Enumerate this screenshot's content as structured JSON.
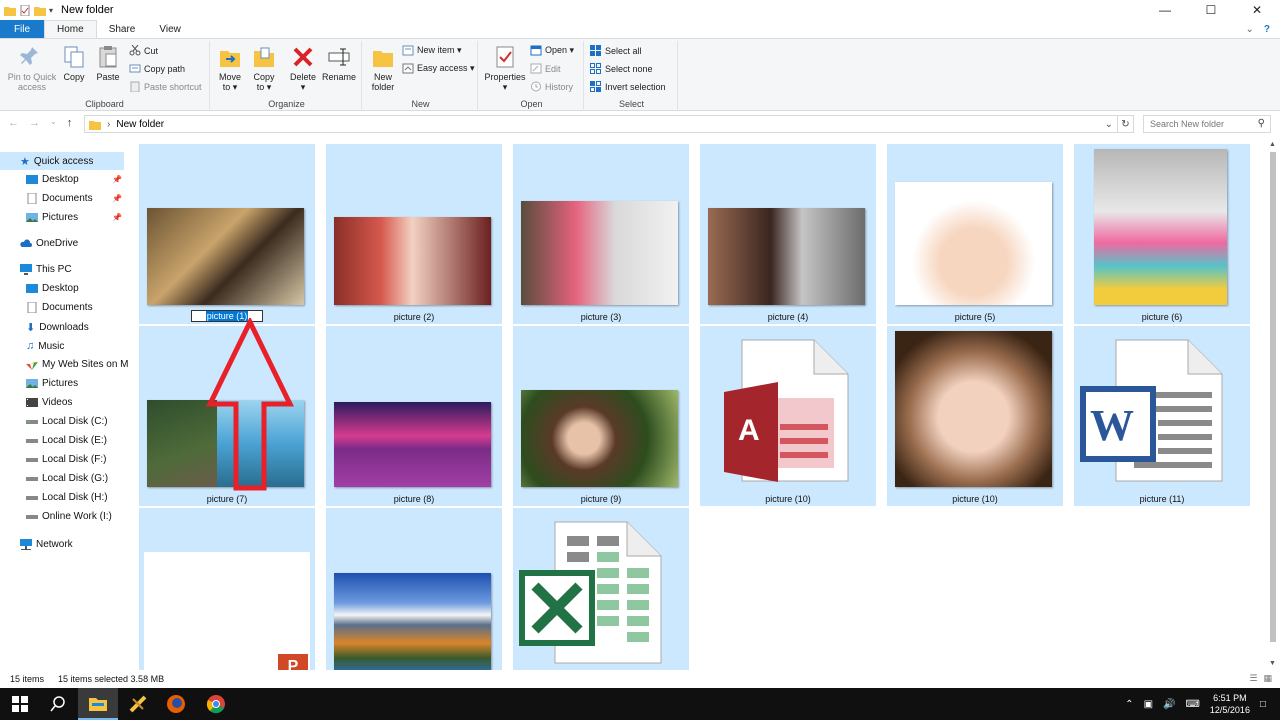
{
  "window": {
    "title": "New folder",
    "controls": [
      "minimize",
      "maximize",
      "close"
    ]
  },
  "tabs": {
    "file": "File",
    "home": "Home",
    "share": "Share",
    "view": "View"
  },
  "ribbon": {
    "clipboard": {
      "label": "Clipboard",
      "pin": "Pin to Quick access",
      "pin_l1": "Pin to Quick",
      "pin_l2": "access",
      "copy": "Copy",
      "paste": "Paste",
      "cut": "Cut",
      "copy_path": "Copy path",
      "paste_shortcut": "Paste shortcut"
    },
    "organize": {
      "label": "Organize",
      "move_l1": "Move",
      "move_l2": "to ▾",
      "copy_l1": "Copy",
      "copy_l2": "to ▾",
      "delete_l1": "Delete",
      "delete_l2": "▾",
      "rename": "Rename"
    },
    "new": {
      "label": "New",
      "folder_l1": "New",
      "folder_l2": "folder",
      "new_item": "New item ▾",
      "easy_access": "Easy access ▾"
    },
    "open": {
      "label": "Open",
      "properties_l1": "Properties",
      "properties_l2": "▾",
      "open": "Open ▾",
      "edit": "Edit",
      "history": "History"
    },
    "select": {
      "label": "Select",
      "select_all": "Select all",
      "select_none": "Select none",
      "invert": "Invert selection"
    }
  },
  "address": {
    "path": "New folder",
    "search_placeholder": "Search New folder"
  },
  "nav_pane": {
    "quick_access": "Quick access",
    "qa_items": [
      "Desktop",
      "Documents",
      "Pictures"
    ],
    "onedrive": "OneDrive",
    "this_pc": "This PC",
    "pc_items": [
      "Desktop",
      "Documents",
      "Downloads",
      "Music",
      "My Web Sites on M",
      "Pictures",
      "Videos",
      "Local Disk (C:)",
      "Local Disk (E:)",
      "Local Disk (F:)",
      "Local Disk (G:)",
      "Local Disk (H:)",
      "Online Work (I:)"
    ],
    "network": "Network"
  },
  "files": [
    {
      "name": "picture (1)",
      "kind": "photo",
      "renaming": true
    },
    {
      "name": "picture (2)",
      "kind": "photo"
    },
    {
      "name": "picture (3)",
      "kind": "photo"
    },
    {
      "name": "picture (4)",
      "kind": "photo"
    },
    {
      "name": "picture (5)",
      "kind": "photo"
    },
    {
      "name": "picture (6)",
      "kind": "photo"
    },
    {
      "name": "picture (7)",
      "kind": "photo"
    },
    {
      "name": "picture (8)",
      "kind": "photo"
    },
    {
      "name": "picture (9)",
      "kind": "photo"
    },
    {
      "name": "picture (10)",
      "kind": "access-doc"
    },
    {
      "name": "picture (10)",
      "kind": "photo"
    },
    {
      "name": "picture (11)",
      "kind": "word-doc"
    },
    {
      "name": "",
      "kind": "powerpoint-doc"
    },
    {
      "name": "",
      "kind": "photo"
    },
    {
      "name": "",
      "kind": "excel-doc"
    }
  ],
  "status": {
    "count": "15 items",
    "selected": "15 items selected  3.58 MB"
  },
  "taskbar": {
    "time": "6:51 PM",
    "date": "12/5/2016"
  },
  "colors": {
    "selection": "#cce8ff",
    "file_tab": "#1979ca",
    "annotation_arrow": "#e8202a"
  }
}
